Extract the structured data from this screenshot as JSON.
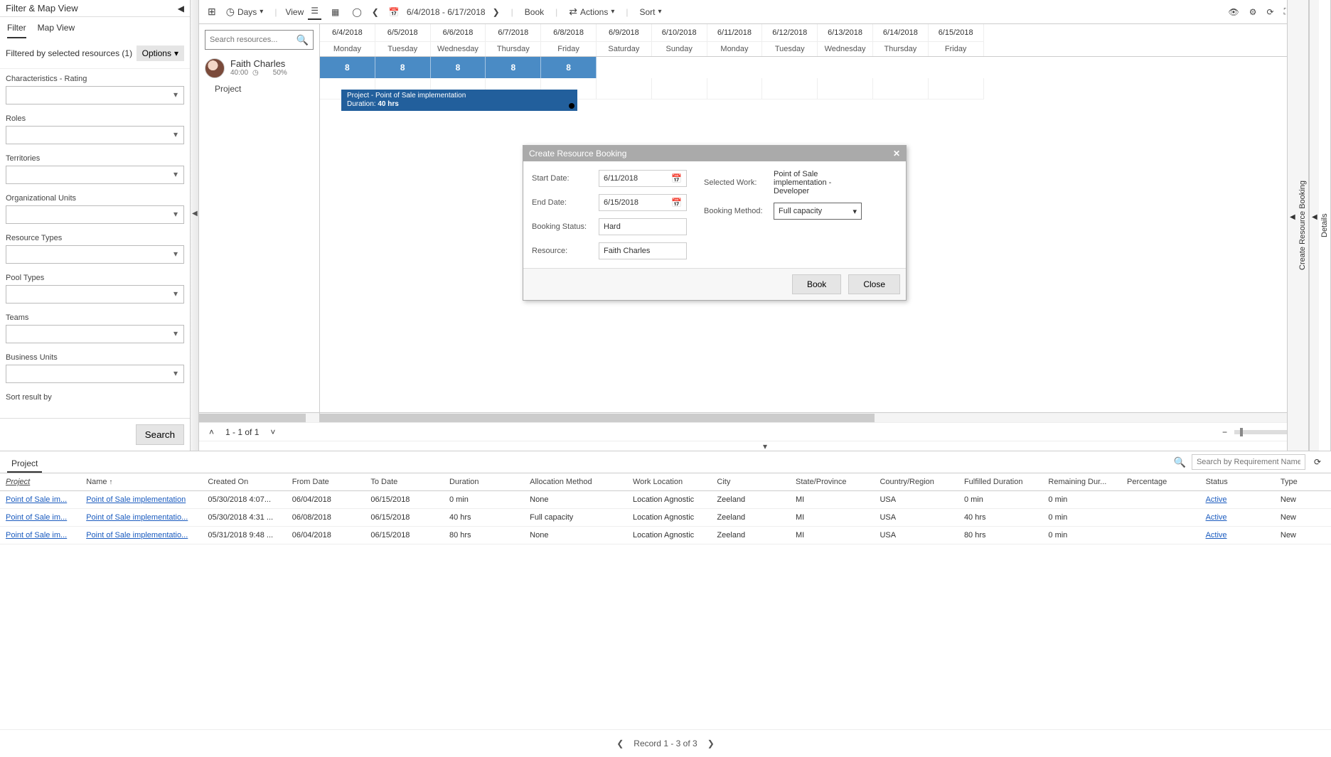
{
  "filterPanel": {
    "title": "Filter & Map View",
    "tabs": {
      "filter": "Filter",
      "map": "Map View"
    },
    "filteredText": "Filtered by selected resources (1)",
    "optionsLabel": "Options",
    "fields": {
      "characteristics": "Characteristics - Rating",
      "roles": "Roles",
      "territories": "Territories",
      "orgUnits": "Organizational Units",
      "resourceTypes": "Resource Types",
      "poolTypes": "Pool Types",
      "teams": "Teams",
      "businessUnits": "Business Units",
      "sortResultBy": "Sort result by"
    },
    "searchBtn": "Search"
  },
  "toolbar": {
    "daysLabel": "Days",
    "viewLabel": "View",
    "dateRange": "6/4/2018 - 6/17/2018",
    "bookLabel": "Book",
    "actionsLabel": "Actions",
    "sortLabel": "Sort"
  },
  "resourceSearchPlaceholder": "Search resources...",
  "resource": {
    "name": "Faith Charles",
    "hours": "40:00",
    "percent": "50%",
    "groupLabel": "Project"
  },
  "calendar": {
    "dates": [
      "6/4/2018",
      "6/5/2018",
      "6/6/2018",
      "6/7/2018",
      "6/8/2018",
      "6/9/2018",
      "6/10/2018",
      "6/11/2018",
      "6/12/2018",
      "6/13/2018",
      "6/14/2018",
      "6/15/2018"
    ],
    "days": [
      "Monday",
      "Tuesday",
      "Wednesday",
      "Thursday",
      "Friday",
      "Saturday",
      "Sunday",
      "Monday",
      "Tuesday",
      "Wednesday",
      "Thursday",
      "Friday"
    ],
    "hours": [
      "8",
      "8",
      "8",
      "8",
      "8",
      "",
      "",
      "",
      "",
      "",
      "",
      ""
    ]
  },
  "bookingBar": {
    "title": "Project - Point of Sale implementation",
    "durationLabel": "Duration:",
    "duration": "40 hrs"
  },
  "modal": {
    "title": "Create Resource Booking",
    "startDateLabel": "Start Date:",
    "startDate": "6/11/2018",
    "endDateLabel": "End Date:",
    "endDate": "6/15/2018",
    "bookingStatusLabel": "Booking Status:",
    "bookingStatus": "Hard",
    "resourceLabel": "Resource:",
    "resource": "Faith Charles",
    "selectedWorkLabel": "Selected Work:",
    "selectedWork": "Point of Sale implementation - Developer",
    "bookingMethodLabel": "Booking Method:",
    "bookingMethod": "Full capacity",
    "bookBtn": "Book",
    "closeBtn": "Close"
  },
  "rightTabs": {
    "createBooking": "Create Resource Booking",
    "details": "Details"
  },
  "schedFooter": {
    "pageText": "1 - 1 of 1"
  },
  "projectTab": "Project",
  "projectSearchPlaceholder": "Search by Requirement Name",
  "gridHeaders": {
    "project": "Project",
    "name": "Name",
    "createdOn": "Created On",
    "fromDate": "From Date",
    "toDate": "To Date",
    "duration": "Duration",
    "allocationMethod": "Allocation Method",
    "workLocation": "Work Location",
    "city": "City",
    "state": "State/Province",
    "country": "Country/Region",
    "fulfilledDuration": "Fulfilled Duration",
    "remainingDuration": "Remaining Dur...",
    "percentage": "Percentage",
    "status": "Status",
    "type": "Type"
  },
  "gridRows": [
    {
      "project": "Point of Sale im...",
      "name": "Point of Sale implementation",
      "createdOn": "05/30/2018 4:07...",
      "fromDate": "06/04/2018",
      "toDate": "06/15/2018",
      "duration": "0 min",
      "allocation": "None",
      "workLoc": "Location Agnostic",
      "city": "Zeeland",
      "state": "MI",
      "country": "USA",
      "fulfilled": "0 min",
      "remaining": "0 min",
      "pct": "",
      "status": "Active",
      "type": "New"
    },
    {
      "project": "Point of Sale im...",
      "name": "Point of Sale implementatio...",
      "createdOn": "05/30/2018 4:31 ...",
      "fromDate": "06/08/2018",
      "toDate": "06/15/2018",
      "duration": "40 hrs",
      "allocation": "Full capacity",
      "workLoc": "Location Agnostic",
      "city": "Zeeland",
      "state": "MI",
      "country": "USA",
      "fulfilled": "40 hrs",
      "remaining": "0 min",
      "pct": "",
      "status": "Active",
      "type": "New"
    },
    {
      "project": "Point of Sale im...",
      "name": "Point of Sale implementatio...",
      "createdOn": "05/31/2018 9:48 ...",
      "fromDate": "06/04/2018",
      "toDate": "06/15/2018",
      "duration": "80 hrs",
      "allocation": "None",
      "workLoc": "Location Agnostic",
      "city": "Zeeland",
      "state": "MI",
      "country": "USA",
      "fulfilled": "80 hrs",
      "remaining": "0 min",
      "pct": "",
      "status": "Active",
      "type": "New"
    }
  ],
  "gridFooter": "Record 1 - 3 of 3"
}
